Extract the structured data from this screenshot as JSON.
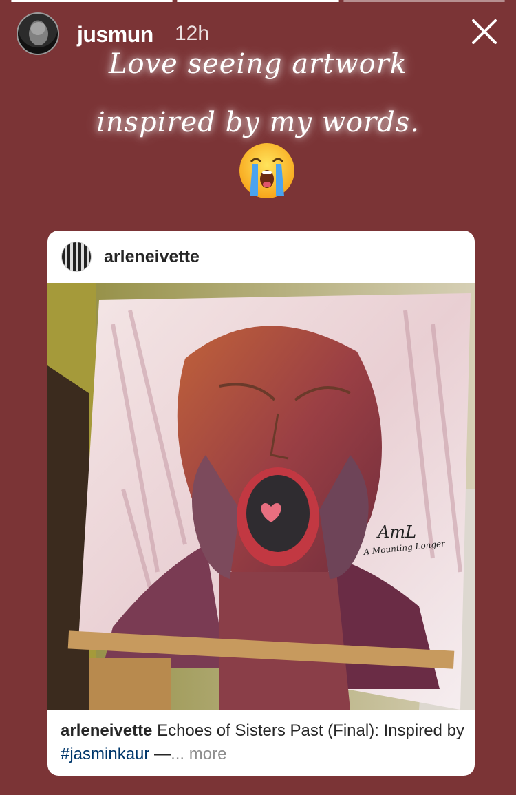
{
  "story": {
    "progress_segments": [
      {
        "state": "done"
      },
      {
        "state": "done"
      },
      {
        "state": "pending"
      }
    ],
    "username": "jusmun",
    "timestamp": "12h",
    "close_icon": "close-icon"
  },
  "caption": {
    "line1": "Love seeing artwork",
    "line2": "inspired by my words.",
    "emoji": "loudly-crying-face"
  },
  "post": {
    "username": "arleneivette",
    "caption_user": "arleneivette",
    "caption_text": " Echoes of Sisters Past (Final): Inspired by ",
    "hashtag": "#jasminkaur",
    "dash": " —",
    "more": "... more",
    "signature_initials": "AmL",
    "signature_name": "A Mounting Longer"
  },
  "colors": {
    "background": "#7b3436",
    "card": "#ffffff",
    "hashtag": "#00376b",
    "muted": "#8e8e8e"
  }
}
